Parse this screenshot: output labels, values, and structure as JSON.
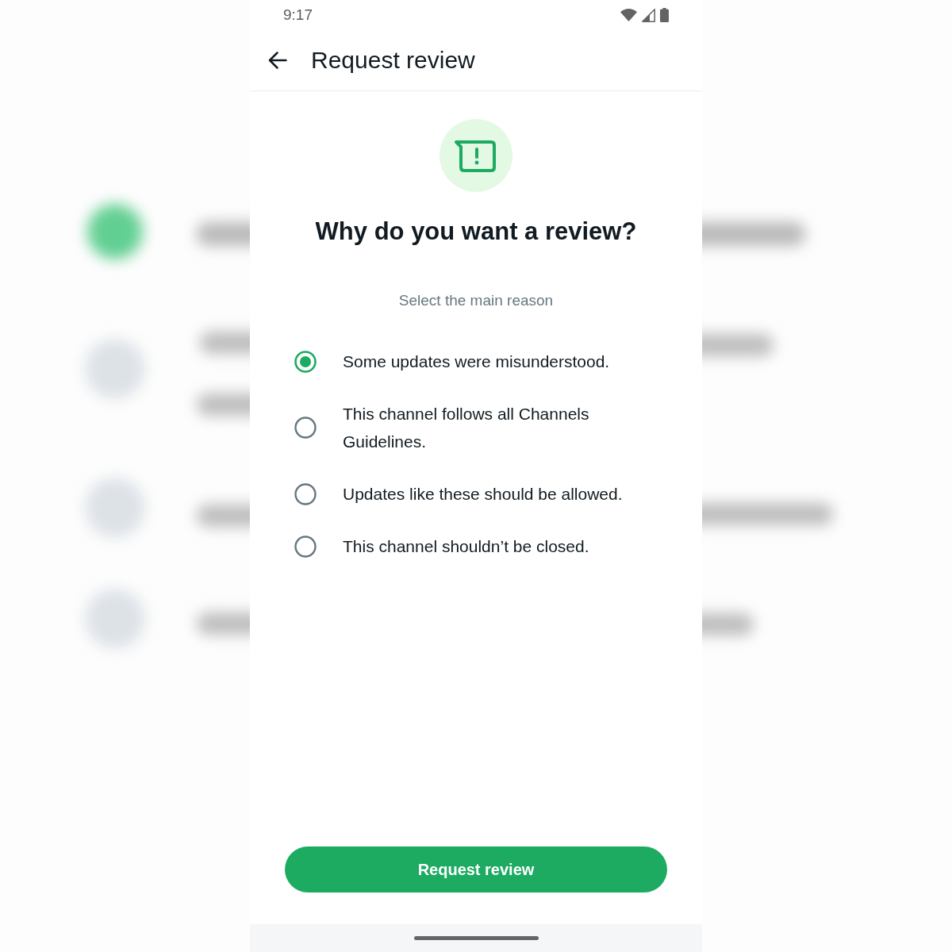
{
  "status_bar": {
    "time": "9:17"
  },
  "header": {
    "title": "Request review"
  },
  "prompt": {
    "heading": "Why do you want a review?",
    "subheading": "Select the main reason"
  },
  "reasons": [
    {
      "label": "Some updates were misunderstood.",
      "selected": true
    },
    {
      "label": "This channel follows all Channels Guidelines.",
      "selected": false
    },
    {
      "label": "Updates like these should be allowed.",
      "selected": false
    },
    {
      "label": "This channel shouldn’t be closed.",
      "selected": false
    }
  ],
  "primary_button": {
    "label": "Request review"
  }
}
